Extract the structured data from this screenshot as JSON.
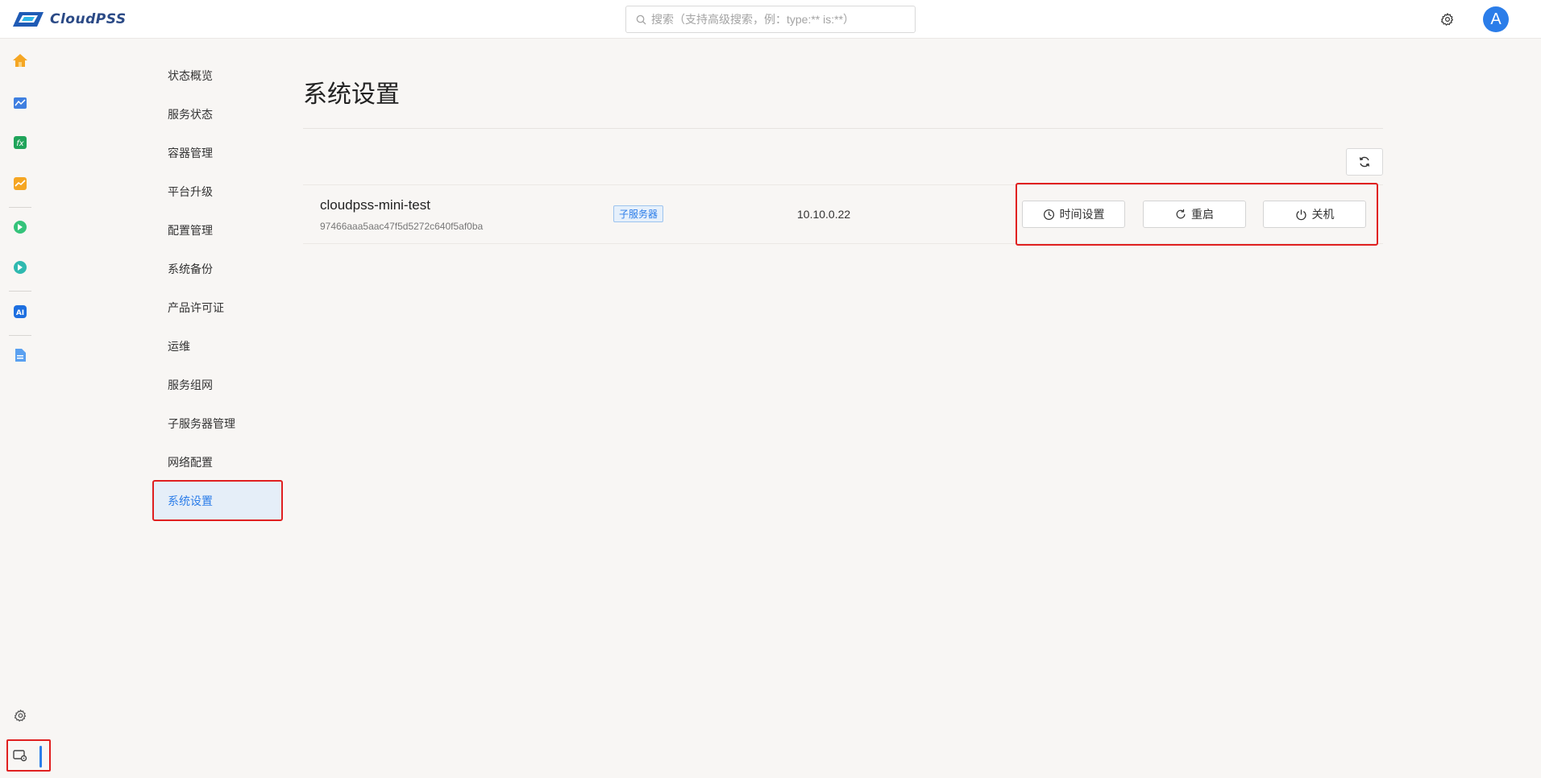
{
  "app": {
    "logo_text": "CloudPSS"
  },
  "search": {
    "placeholder": "搜索（支持高级搜索，例：type:** is:**）",
    "value": ""
  },
  "user": {
    "avatar_letter": "A"
  },
  "subnav": {
    "items": [
      {
        "label": "状态概览"
      },
      {
        "label": "服务状态"
      },
      {
        "label": "容器管理"
      },
      {
        "label": "平台升级"
      },
      {
        "label": "配置管理"
      },
      {
        "label": "系统备份"
      },
      {
        "label": "产品许可证"
      },
      {
        "label": "运维"
      },
      {
        "label": "服务组网"
      },
      {
        "label": "子服务器管理"
      },
      {
        "label": "网络配置"
      },
      {
        "label": "系统设置",
        "active": true
      }
    ]
  },
  "main": {
    "title": "系统设置",
    "server": {
      "name": "cloudpss-mini-test",
      "id": "97466aaa5aac47f5d5272c640f5af0ba",
      "tag": "子服务器",
      "ip": "10.10.0.22"
    },
    "actions": {
      "time_label": "时间设置",
      "restart_label": "重启",
      "shutdown_label": "关机"
    }
  },
  "icons": {
    "rail": [
      "home-icon",
      "monitor-chart-icon",
      "function-icon",
      "trend-icon",
      "app-green-icon",
      "app-teal-icon",
      "ai-icon",
      "document-icon",
      "settings-icon",
      "system-admin-icon"
    ],
    "top": [
      "search-icon",
      "gear-icon"
    ],
    "actions": [
      "clock-icon",
      "refresh-icon",
      "power-icon"
    ]
  },
  "colors": {
    "accent": "#2b7de9",
    "highlight_border": "#e02020",
    "active_nav_bg": "#e5eef8",
    "background": "#f8f6f4"
  }
}
